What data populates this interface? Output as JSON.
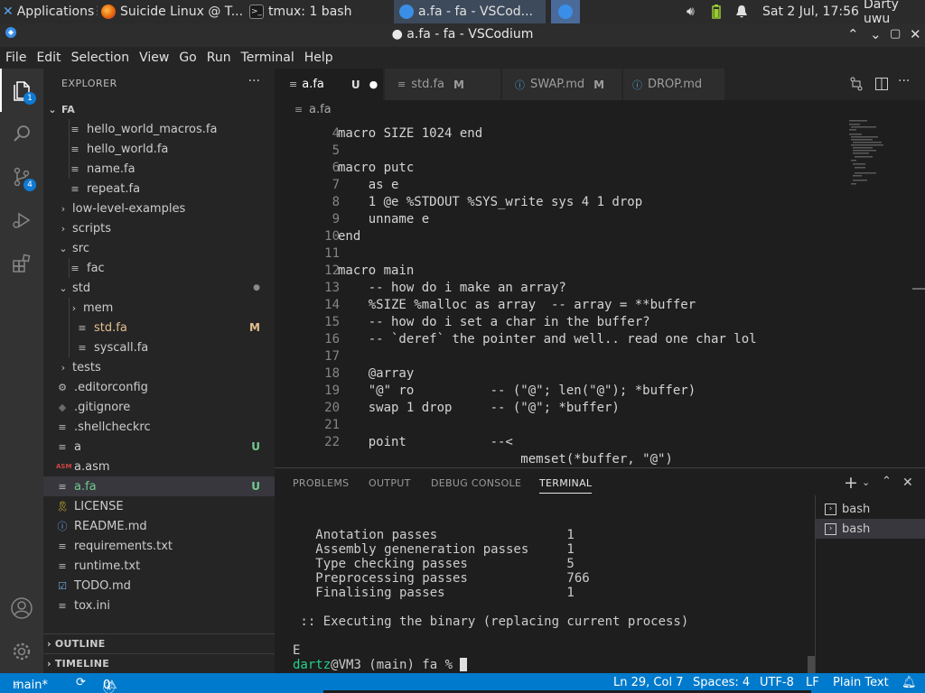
{
  "os_panel": {
    "applications": "Applications",
    "tasks": [
      {
        "label": "Suicide Linux @ T..."
      },
      {
        "label": "tmux: 1 bash"
      },
      {
        "label": "a.fa - fa - VSCod..."
      }
    ],
    "datetime": "Sat  2 Jul, 17:56",
    "user": "Darty uwu"
  },
  "window": {
    "title": "● a.fa - fa - VSCodium"
  },
  "menu": [
    "File",
    "Edit",
    "Selection",
    "View",
    "Go",
    "Run",
    "Terminal",
    "Help"
  ],
  "activity": {
    "explorer_badge": "1",
    "scm_badge": "4"
  },
  "explorer": {
    "header": "EXPLORER",
    "more": "···",
    "root": "FA",
    "rows": [
      {
        "name": "hello_world_macros.fa",
        "status": ""
      },
      {
        "name": "hello_world.fa",
        "status": ""
      },
      {
        "name": "name.fa",
        "status": ""
      },
      {
        "name": "repeat.fa",
        "status": ""
      },
      {
        "name": "low-level-examples",
        "status": ""
      },
      {
        "name": "scripts",
        "status": ""
      },
      {
        "name": "src",
        "status": ""
      },
      {
        "name": "fac",
        "status": ""
      },
      {
        "name": "std",
        "status": ""
      },
      {
        "name": "mem",
        "status": ""
      },
      {
        "name": "std.fa",
        "status": "M"
      },
      {
        "name": "syscall.fa",
        "status": ""
      },
      {
        "name": "tests",
        "status": ""
      },
      {
        "name": ".editorconfig",
        "status": ""
      },
      {
        "name": ".gitignore",
        "status": ""
      },
      {
        "name": ".shellcheckrc",
        "status": ""
      },
      {
        "name": "a",
        "status": "U"
      },
      {
        "name": "a.asm",
        "status": ""
      },
      {
        "name": "a.fa",
        "status": "U"
      },
      {
        "name": "LICENSE",
        "status": ""
      },
      {
        "name": "README.md",
        "status": ""
      },
      {
        "name": "requirements.txt",
        "status": ""
      },
      {
        "name": "runtime.txt",
        "status": ""
      },
      {
        "name": "TODO.md",
        "status": ""
      },
      {
        "name": "tox.ini",
        "status": ""
      }
    ],
    "outline": "OUTLINE",
    "timeline": "TIMELINE"
  },
  "editor": {
    "tabs": [
      {
        "name": "a.fa",
        "status": "U"
      },
      {
        "name": "std.fa",
        "status": "M"
      },
      {
        "name": "SWAP.md",
        "status": "M"
      },
      {
        "name": "DROP.md",
        "status": ""
      }
    ],
    "breadcrumb": "a.fa",
    "lines": [
      {
        "n": "4",
        "text": "macro SIZE 1024 end"
      },
      {
        "n": "5",
        "text": ""
      },
      {
        "n": "6",
        "text": "macro putc"
      },
      {
        "n": "7",
        "text": "    as e"
      },
      {
        "n": "8",
        "text": "    1 @e %STDOUT %SYS_write sys 4 1 drop"
      },
      {
        "n": "9",
        "text": "    unname e"
      },
      {
        "n": "10",
        "text": "end"
      },
      {
        "n": "11",
        "text": ""
      },
      {
        "n": "12",
        "text": "macro main"
      },
      {
        "n": "13",
        "text": "    -- how do i make an array?"
      },
      {
        "n": "14",
        "text": "    %SIZE %malloc as array  -- array = **buffer"
      },
      {
        "n": "15",
        "text": "    -- how do i set a char in the buffer?"
      },
      {
        "n": "16",
        "text": "    -- `deref` the pointer and well.. read one char lol"
      },
      {
        "n": "17",
        "text": ""
      },
      {
        "n": "18",
        "text": "    @array"
      },
      {
        "n": "19",
        "text": "    \"@\" ro          -- (\"@\"; len(\"@\"); *buffer)"
      },
      {
        "n": "20",
        "text": "    swap 1 drop     -- (\"@\"; *buffer)"
      },
      {
        "n": "21",
        "text": ""
      },
      {
        "n": "22",
        "text": "    point           --<"
      },
      {
        "n": "",
        "text": "                        memset(*buffer, \"@\")"
      }
    ]
  },
  "panel": {
    "tabs": [
      "PROBLEMS",
      "OUTPUT",
      "DEBUG CONSOLE",
      "TERMINAL"
    ],
    "terminal_lines": [
      "   Anotation passes                 1",
      "   Assembly geneneration passes     1",
      "   Type checking passes             5",
      "   Preprocessing passes             766",
      "   Finalising passes                1",
      "",
      " :: Executing the binary (replacing current process)",
      "",
      "E"
    ],
    "prompt_user": "dartz",
    "prompt_rest": "@VM3 (main) fa % ",
    "terminals": [
      "bash",
      "bash"
    ]
  },
  "statusbar": {
    "branch": "main*",
    "errors": "0",
    "warnings": "0",
    "position": "Ln 29, Col 7",
    "spaces": "Spaces: 4",
    "encoding": "UTF-8",
    "eol": "LF",
    "language": "Plain Text"
  },
  "colors": {
    "accent": "#007acc",
    "modified": "#e2c08d",
    "untracked": "#73c991",
    "prompt_user": "#23d18b"
  }
}
